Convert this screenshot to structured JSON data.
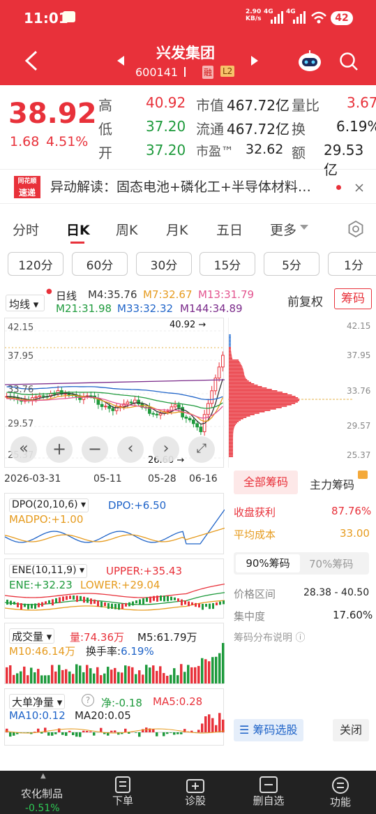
{
  "status": {
    "time": "11:01",
    "net_speed_top": "2.90",
    "net_speed_bottom": "KB/s",
    "net1": "4G",
    "net2": "4G",
    "battery": "42"
  },
  "header": {
    "name": "兴发集团",
    "code": "600141",
    "tag_rong": "融",
    "tag_level": "L2"
  },
  "quote": {
    "price": "38.92",
    "change": "1.68",
    "change_pct": "4.51%",
    "high_label": "高",
    "high": "40.92",
    "low_label": "低",
    "low": "37.20",
    "open_label": "开",
    "open": "37.20",
    "mktcap_label": "市值",
    "mktcap": "467.72亿",
    "float_label": "流通",
    "float": "467.72亿",
    "pe_label": "市盈™",
    "pe": "32.62",
    "volratio_label": "量比",
    "volratio": "3.67",
    "turnover_label": "换",
    "turnover": "6.19%",
    "amount_label": "额",
    "amount": "29.53亿"
  },
  "news": {
    "logo_top": "同花顺",
    "logo_bottom": "速递",
    "text": "异动解读：固态电池+磷化工+半导体材料…"
  },
  "tabs": [
    "分时",
    "日K",
    "周K",
    "月K",
    "五日",
    "更多"
  ],
  "periods": [
    "120分",
    "60分",
    "30分",
    "15分",
    "5分",
    "1分"
  ],
  "kline": {
    "indicator": "均线",
    "day": "日线",
    "m4": "M4:35.76",
    "m7": "M7:32.67",
    "m13": "M13:31.79",
    "m21": "M21:31.98",
    "m33": "M33:32.32",
    "m144": "M144:34.89",
    "fq": "前复权",
    "chouma": "筹码",
    "hi_label": "40.92",
    "lo_label": "26.60",
    "y1": "42.15",
    "y2": "37.95",
    "y3": "33.76",
    "y4": "29.57",
    "y5": "25.37",
    "r1": "42.15",
    "r2": "37.95",
    "r3": "33.76",
    "r4": "29.57",
    "r5": "25.37",
    "d1": "2026-03-31",
    "d2": "05-11",
    "d3": "05-28",
    "d4": "06-16"
  },
  "dpo": {
    "title": "DPO(20,10,6)",
    "dpo": "DPO:+6.50",
    "madpo": "MADPO:+1.00"
  },
  "ene": {
    "title": "ENE(10,11,9)",
    "upper": "UPPER:+35.43",
    "ene": "ENE:+32.23",
    "lower": "LOWER:+29.04"
  },
  "vol": {
    "title": "成交量",
    "vol": "量:74.36万",
    "m5": "M5:61.79万",
    "m10": "M10:46.14万",
    "turn_label": "换手率:",
    "turn": "6.19%"
  },
  "bigorder": {
    "title": "大单净量",
    "net": "净:-0.18",
    "ma5": "MA5:0.28",
    "ma10": "MA10:0.12",
    "ma20": "MA20:0.05"
  },
  "chip": {
    "tab1": "全部筹码",
    "tab2": "主力筹码",
    "profit_label": "收盘获利",
    "profit": "87.76%",
    "cost_label": "平均成本",
    "cost": "33.00",
    "p90": "90%筹码",
    "p70": "70%筹码",
    "range_label": "价格区间",
    "range": "28.38 - 40.50",
    "conc_label": "集中度",
    "conc": "17.60%",
    "desc": "筹码分布说明",
    "select": "筹码选股",
    "close": "关闭"
  },
  "bottom": {
    "sector": "农化制品",
    "sector_chg": "-0.51%",
    "b1": "下单",
    "b2": "诊股",
    "b3": "删自选",
    "b4": "功能"
  },
  "colors": {
    "red": "#e8313a",
    "green": "#1e9a3c",
    "blue": "#1e63c8"
  }
}
